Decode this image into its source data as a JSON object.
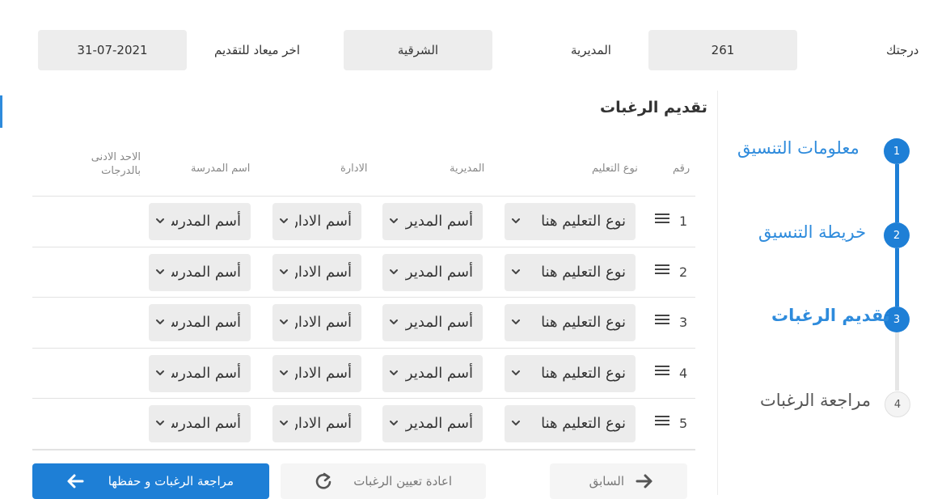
{
  "header": {
    "grade_label": "درجتك",
    "grade_value": "261",
    "directorate_label": "المديرية",
    "directorate_value": "الشرقية",
    "deadline_label": "اخر ميعاد للتقديم",
    "deadline_value": "31-07-2021"
  },
  "section": {
    "title": "تقديم الرغبات",
    "columns": {
      "number": "رقم",
      "education_type": "نوع التعليم",
      "directorate": "المديرية",
      "administration": "الادارة",
      "school_name": "اسم المدرسة",
      "min_grade": "الاحد الادنى بالدرجات"
    },
    "rows": [
      {
        "number": "1",
        "education_type": "نوع التعليم هنا",
        "directorate": "أسم المديرية",
        "administration": "أسم الادارة",
        "school": "أسم المدرسة"
      },
      {
        "number": "2",
        "education_type": "نوع التعليم هنا",
        "directorate": "أسم المديرية",
        "administration": "أسم الادارة",
        "school": "أسم المدرسة"
      },
      {
        "number": "3",
        "education_type": "نوع التعليم هنا",
        "directorate": "أسم المديرية",
        "administration": "أسم الادارة",
        "school": "أسم المدرسة"
      },
      {
        "number": "4",
        "education_type": "نوع التعليم هنا",
        "directorate": "أسم المديرية",
        "administration": "أسم الادارة",
        "school": "أسم المدرسة"
      },
      {
        "number": "5",
        "education_type": "نوع التعليم هنا",
        "directorate": "أسم المديرية",
        "administration": "أسم الادارة",
        "school": "أسم المدرسة"
      }
    ]
  },
  "steps": [
    {
      "number": "1",
      "label": "معلومات التنسيق",
      "state": "complete"
    },
    {
      "number": "2",
      "label": "خريطة التنسيق",
      "state": "complete"
    },
    {
      "number": "3",
      "label": "تقديم الرغبات",
      "state": "active"
    },
    {
      "number": "4",
      "label": "مراجعة الرغبات",
      "state": "inactive"
    }
  ],
  "buttons": {
    "review_save": "مراجعة الرغبات و حفظها",
    "reset": "اعادة تعيين الرغبات",
    "previous": "السابق"
  },
  "colors": {
    "accent": "#1e7fd6",
    "field_bg": "#ededed"
  }
}
